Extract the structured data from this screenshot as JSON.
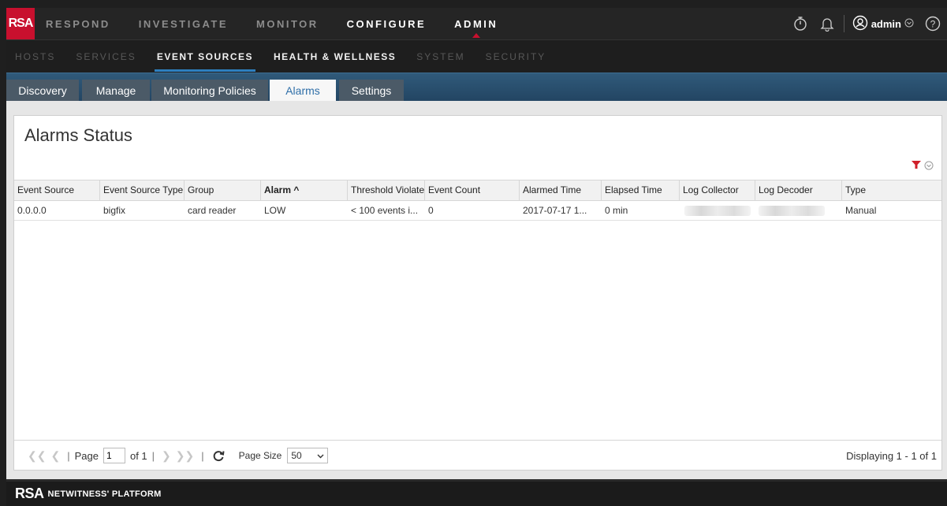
{
  "topnav": {
    "logo": "RSA",
    "items": [
      {
        "label": "RESPOND"
      },
      {
        "label": "INVESTIGATE"
      },
      {
        "label": "MONITOR"
      },
      {
        "label": "CONFIGURE"
      },
      {
        "label": "ADMIN"
      }
    ],
    "user": "admin",
    "icons": [
      "stopwatch-icon",
      "bell-icon",
      "user-icon",
      "chevron-down-icon",
      "help-icon"
    ]
  },
  "subnav": {
    "items": [
      {
        "label": "HOSTS"
      },
      {
        "label": "SERVICES"
      },
      {
        "label": "EVENT SOURCES"
      },
      {
        "label": "HEALTH & WELLNESS"
      },
      {
        "label": "SYSTEM"
      },
      {
        "label": "SECURITY"
      }
    ]
  },
  "tabs": [
    {
      "label": "Discovery"
    },
    {
      "label": "Manage"
    },
    {
      "label": "Monitoring Policies"
    },
    {
      "label": "Alarms"
    },
    {
      "label": "Settings"
    }
  ],
  "panel": {
    "title": "Alarms Status",
    "columns": [
      {
        "label": "Event Source"
      },
      {
        "label": "Event Source Type"
      },
      {
        "label": "Group"
      },
      {
        "label": "Alarm ^"
      },
      {
        "label": "Threshold Violated"
      },
      {
        "label": "Event Count"
      },
      {
        "label": "Alarmed Time"
      },
      {
        "label": "Elapsed Time"
      },
      {
        "label": "Log Collector"
      },
      {
        "label": "Log Decoder"
      },
      {
        "label": "Type"
      }
    ],
    "rows": [
      {
        "event_source": "0.0.0.0",
        "event_source_type": "bigfix",
        "group": "card reader",
        "alarm": "LOW",
        "threshold": "< 100 events i...",
        "event_count": "0",
        "alarmed_time": "2017-07-17 1...",
        "elapsed_time": "0 min",
        "log_collector": "",
        "log_decoder": "",
        "type": "Manual"
      }
    ]
  },
  "pager": {
    "page_label": "Page",
    "page_value": "1",
    "of_label": "of 1",
    "page_size_label": "Page Size",
    "page_size": "50",
    "displaying": "Displaying 1 - 1 of 1"
  },
  "footer": {
    "brand": "RSA",
    "product": "NETWITNESS' PLATFORM"
  },
  "colors": {
    "brand_red": "#c8102e",
    "accent_blue": "#2e7fbf",
    "active_tab_text": "#2f6fa8"
  }
}
